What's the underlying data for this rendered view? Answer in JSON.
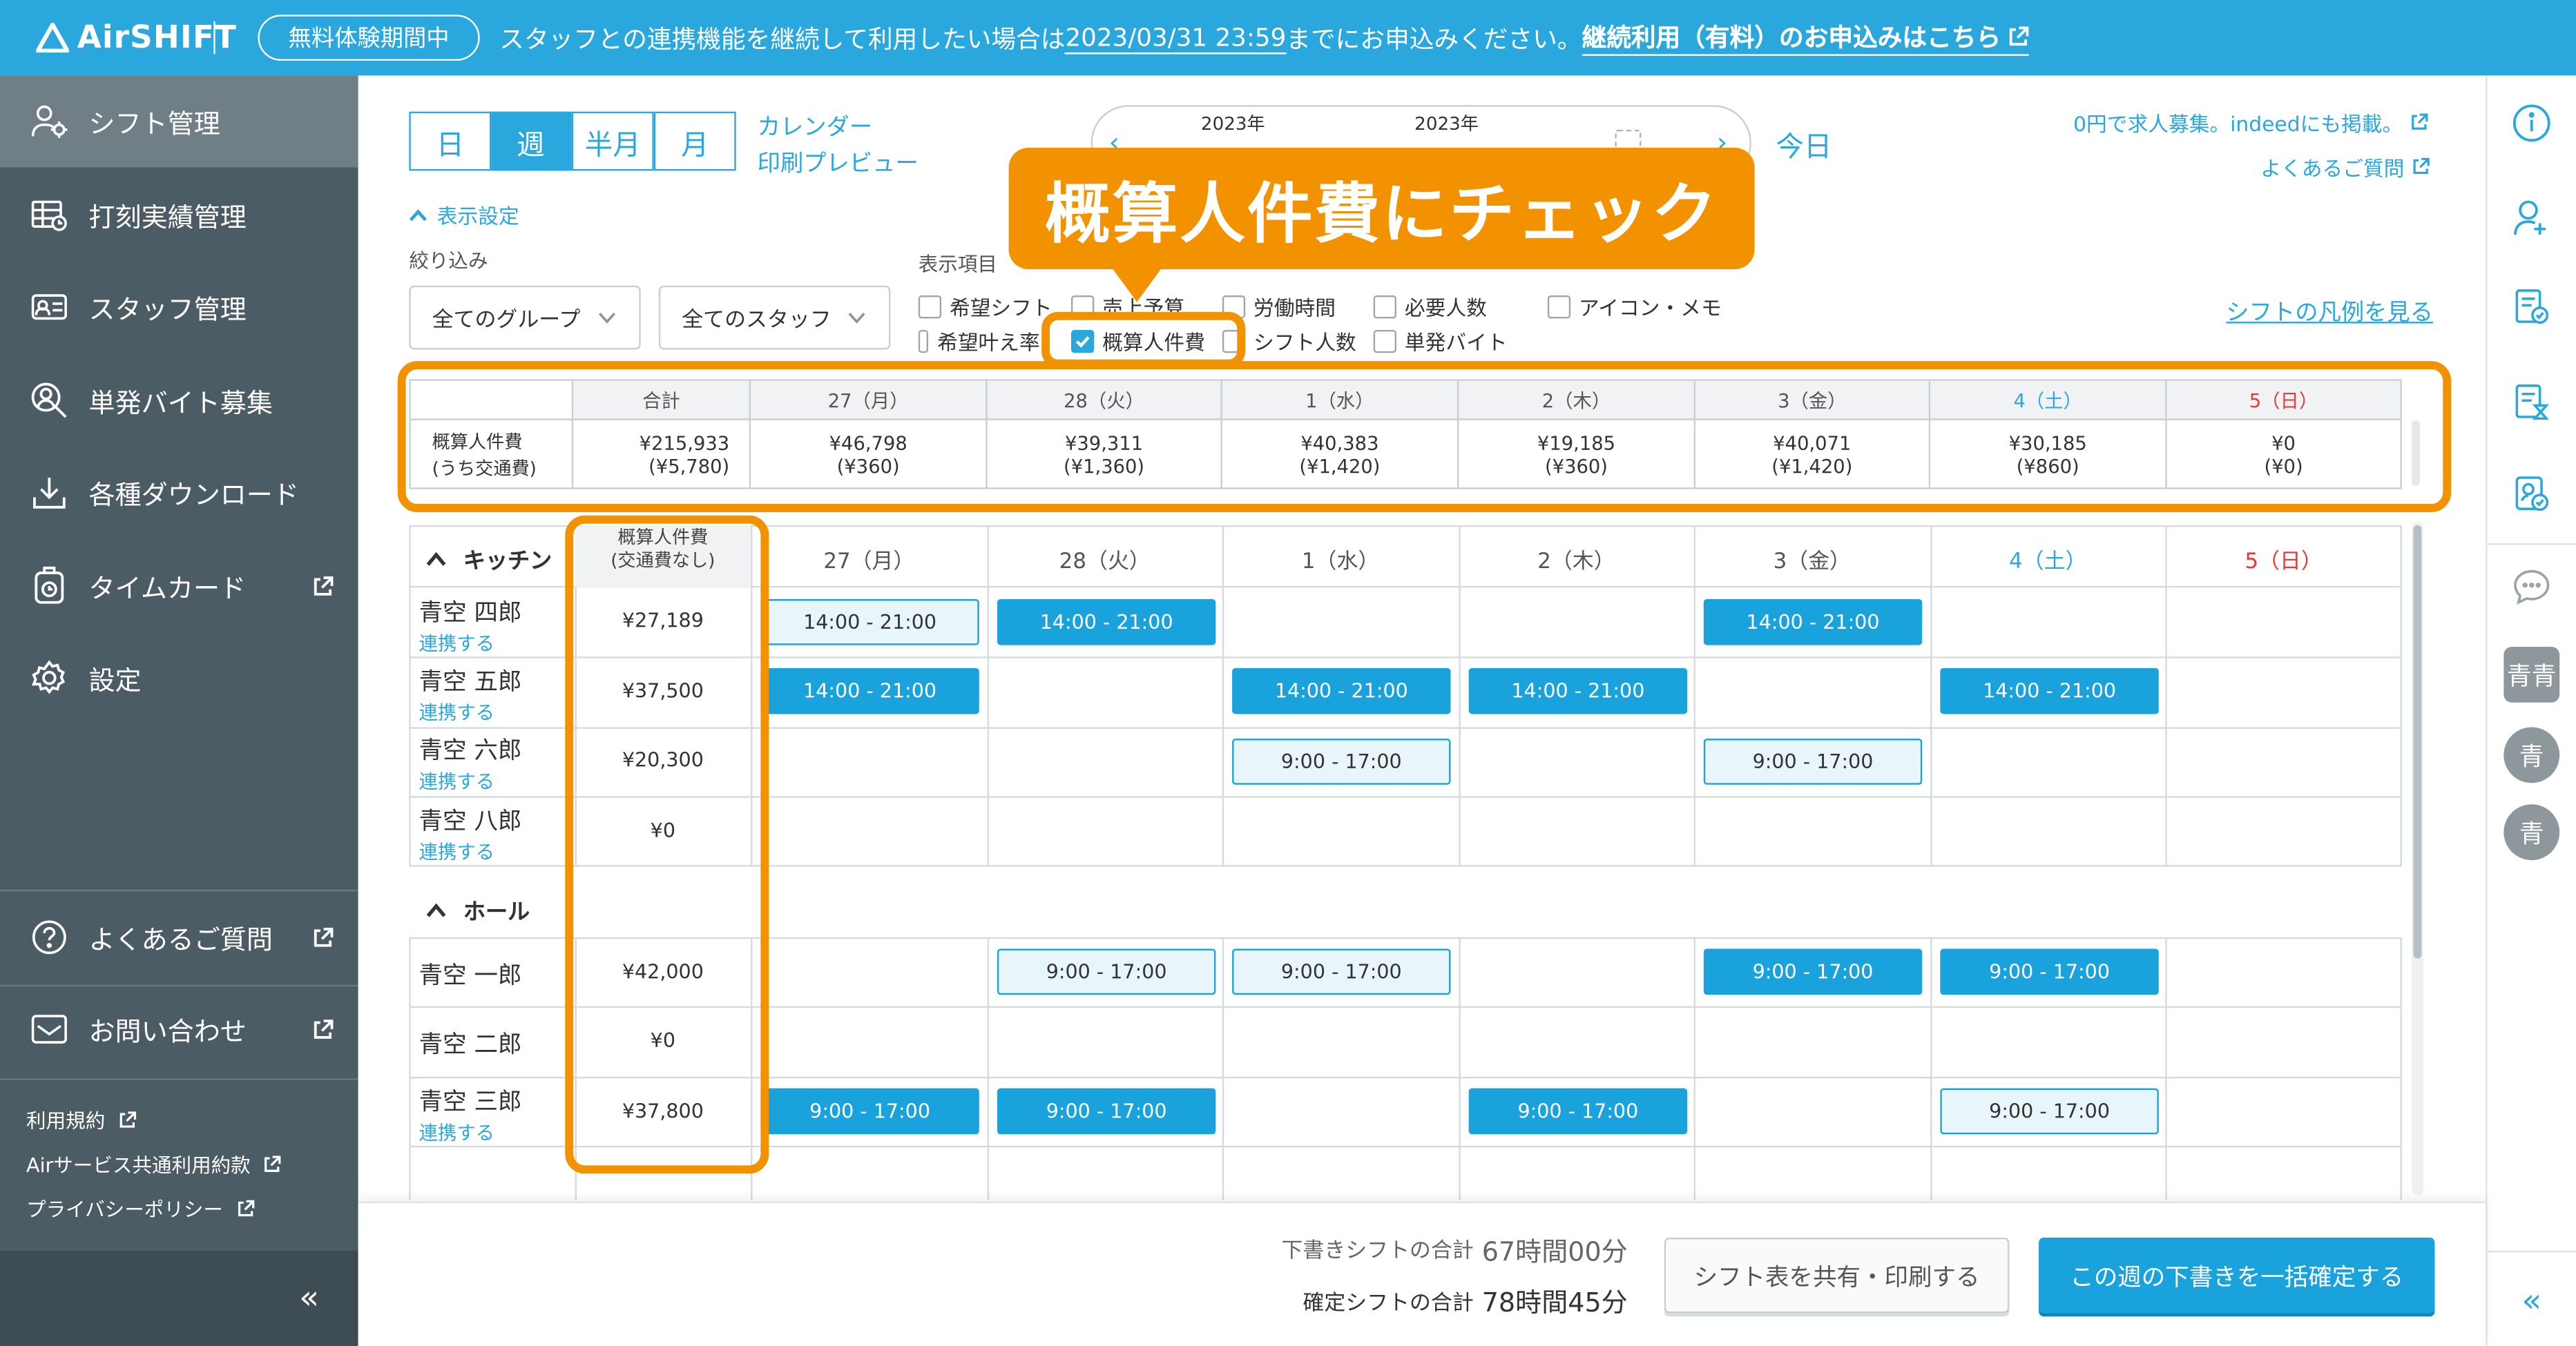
{
  "topbar": {
    "logo": "AirSHIFT",
    "trial_badge": "無料体験期間中",
    "notice_pre": "スタッフとの連携機能を継続して利用したい場合は",
    "notice_date": "2023/03/31 23:59",
    "notice_post": "までにお申込みください。",
    "notice_link": "継続利用（有料）のお申込みはこちら"
  },
  "sidebar": {
    "items": [
      {
        "label": "シフト管理",
        "icon": "people-gear-icon"
      },
      {
        "label": "打刻実績管理",
        "icon": "table-icon"
      },
      {
        "label": "スタッフ管理",
        "icon": "id-card-icon"
      },
      {
        "label": "単発バイト募集",
        "icon": "person-search-icon"
      },
      {
        "label": "各種ダウンロード",
        "icon": "download-icon"
      },
      {
        "label": "タイムカード",
        "icon": "timecard-icon"
      },
      {
        "label": "設定",
        "icon": "gear-icon"
      }
    ],
    "help": "よくあるご質問",
    "contact": "お問い合わせ",
    "terms": "利用規約",
    "common_terms": "Airサービス共通利用約款",
    "privacy": "プライバシーポリシー",
    "collapse": "«"
  },
  "toolbar": {
    "view_tabs": [
      "日",
      "週",
      "半月",
      "月"
    ],
    "active_view": "週",
    "calendar_link": "カレンダー",
    "print_preview": "印刷プレビュー",
    "year_left": "2023年",
    "year_right": "2023年",
    "today": "今日",
    "recruit_link": "0円で求人募集。indeedにも掲載。",
    "faq_link": "よくあるご質問"
  },
  "settings": {
    "toggle_label": "表示設定",
    "filter_label": "絞り込み",
    "group_select": "全てのグループ",
    "staff_select": "全てのスタッフ",
    "display_items_label": "表示項目",
    "legend_link": "シフトの凡例を見る",
    "checkboxes": [
      {
        "label": "希望シフト",
        "checked": false
      },
      {
        "label": "売上予算",
        "checked": false
      },
      {
        "label": "労働時間",
        "checked": false
      },
      {
        "label": "必要人数",
        "checked": false
      },
      {
        "label": "アイコン・メモ",
        "checked": false
      },
      {
        "label": "希望叶え率",
        "checked": false
      },
      {
        "label": "概算人件費",
        "checked": true
      },
      {
        "label": "シフト人数",
        "checked": false
      },
      {
        "label": "単発バイト",
        "checked": false
      }
    ]
  },
  "callout": "概算人件費にチェック",
  "summary": {
    "header_total": "合計",
    "days": [
      "27（月）",
      "28（火）",
      "1（水）",
      "2（木）",
      "3（金）",
      "4（土）",
      "5（日）"
    ],
    "row_label_1": "概算人件費",
    "row_label_2": "(うち交通費)",
    "total": "¥215,933",
    "total_sub": "(¥5,780)",
    "values": [
      "¥46,798",
      "¥39,311",
      "¥40,383",
      "¥19,185",
      "¥40,071",
      "¥30,185",
      "¥0"
    ],
    "subs": [
      "(¥360)",
      "(¥1,360)",
      "(¥1,420)",
      "(¥360)",
      "(¥1,420)",
      "(¥860)",
      "(¥0)"
    ]
  },
  "grid": {
    "cost_header_1": "概算人件費",
    "cost_header_2": "(交通費なし)",
    "days": [
      "27（月）",
      "28（火）",
      "1（水）",
      "2（木）",
      "3（金）",
      "4（土）",
      "5（日）"
    ],
    "sections": [
      {
        "name": "キッチン",
        "staff": [
          {
            "name": "青空 四郎",
            "link": "連携する",
            "cost": "¥27,189"
          },
          {
            "name": "青空 五郎",
            "link": "連携する",
            "cost": "¥37,500"
          },
          {
            "name": "青空 六郎",
            "link": "連携する",
            "cost": "¥20,300"
          },
          {
            "name": "青空 八郎",
            "link": "連携する",
            "cost": "¥0"
          }
        ]
      },
      {
        "name": "ホール",
        "staff": [
          {
            "name": "青空 一郎",
            "link": "",
            "cost": "¥42,000"
          },
          {
            "name": "青空 二郎",
            "link": "",
            "cost": "¥0"
          },
          {
            "name": "青空 三郎",
            "link": "連携する",
            "cost": "¥37,800"
          }
        ]
      }
    ],
    "shifts": [
      {
        "row": 0,
        "day": 0,
        "time": "14:00 - 21:00",
        "state": "draft"
      },
      {
        "row": 0,
        "day": 1,
        "time": "14:00 - 21:00",
        "state": "confirmed"
      },
      {
        "row": 0,
        "day": 4,
        "time": "14:00 - 21:00",
        "state": "confirmed"
      },
      {
        "row": 1,
        "day": 0,
        "time": "14:00 - 21:00",
        "state": "confirmed"
      },
      {
        "row": 1,
        "day": 2,
        "time": "14:00 - 21:00",
        "state": "confirmed"
      },
      {
        "row": 1,
        "day": 3,
        "time": "14:00 - 21:00",
        "state": "confirmed"
      },
      {
        "row": 1,
        "day": 5,
        "time": "14:00 - 21:00",
        "state": "confirmed"
      },
      {
        "row": 2,
        "day": 2,
        "time": "9:00 - 17:00",
        "state": "draft"
      },
      {
        "row": 2,
        "day": 4,
        "time": "9:00 - 17:00",
        "state": "draft"
      },
      {
        "row": 4,
        "day": 1,
        "time": "9:00 - 17:00",
        "state": "draft"
      },
      {
        "row": 4,
        "day": 2,
        "time": "9:00 - 17:00",
        "state": "draft"
      },
      {
        "row": 4,
        "day": 4,
        "time": "9:00 - 17:00",
        "state": "confirmed"
      },
      {
        "row": 4,
        "day": 5,
        "time": "9:00 - 17:00",
        "state": "confirmed"
      },
      {
        "row": 6,
        "day": 0,
        "time": "9:00 - 17:00",
        "state": "confirmed"
      },
      {
        "row": 6,
        "day": 1,
        "time": "9:00 - 17:00",
        "state": "confirmed"
      },
      {
        "row": 6,
        "day": 3,
        "time": "9:00 - 17:00",
        "state": "confirmed"
      },
      {
        "row": 6,
        "day": 5,
        "time": "9:00 - 17:00",
        "state": "draft"
      }
    ]
  },
  "footer": {
    "draft_label": "下書きシフトの合計",
    "draft_value": "67時間00分",
    "confirmed_label": "確定シフトの合計",
    "confirmed_value": "78時間45分",
    "share_button": "シフト表を共有・印刷する",
    "confirm_button": "この週の下書きを一括確定する"
  },
  "rsidebar": {
    "avatars": [
      "青青",
      "青",
      "青"
    ],
    "collapse": "«"
  },
  "colors": {
    "brand": "#2aa7dd",
    "highlight": "#f39200",
    "sunday": "#e53935",
    "sidebar": "#4c5c64"
  }
}
